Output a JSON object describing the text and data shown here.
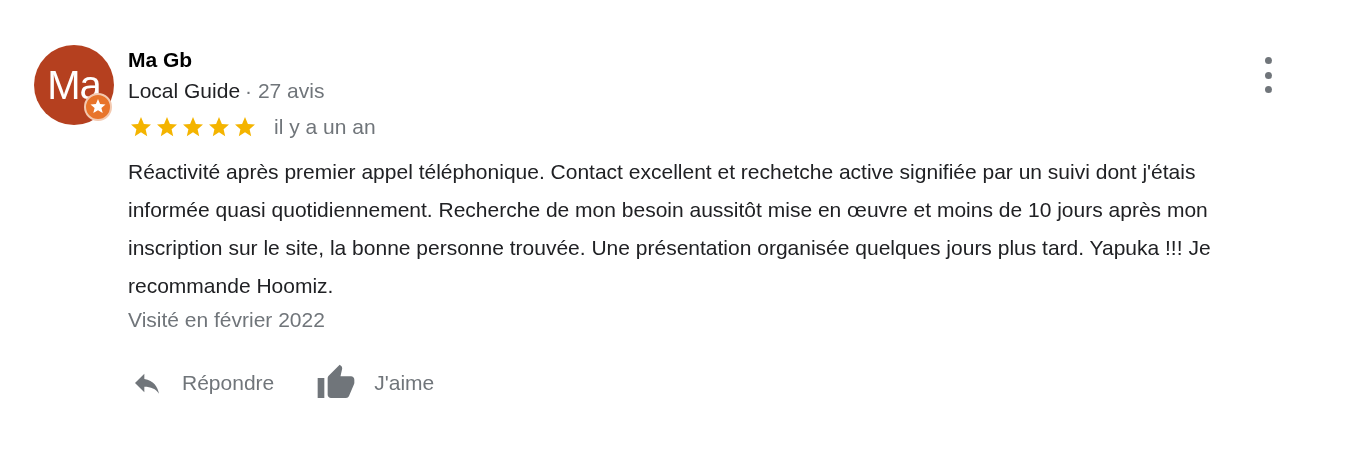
{
  "review": {
    "avatar": {
      "initials": "Ma",
      "badge": true
    },
    "author": "Ma Gb",
    "author_role": "Local Guide",
    "review_count": "· 27 avis",
    "stars": 5,
    "date": "il y a un an",
    "text": "Réactivité après premier appel téléphonique. Contact excellent et rechetche active signifiée par un suivi dont j'étais informée quasi quotidiennement. Recherche de mon besoin aussitôt mise en œuvre et moins de 10 jours après mon inscription sur le site, la bonne personne trouvée. Une présentation organisée quelques jours plus tard. Yapuka !!! Je recommande Hoomiz.",
    "visit": "Visité en février 2022",
    "actions": [
      {
        "kind": "reply",
        "label": "Répondre"
      },
      {
        "kind": "like",
        "label": "J'aime"
      }
    ]
  }
}
